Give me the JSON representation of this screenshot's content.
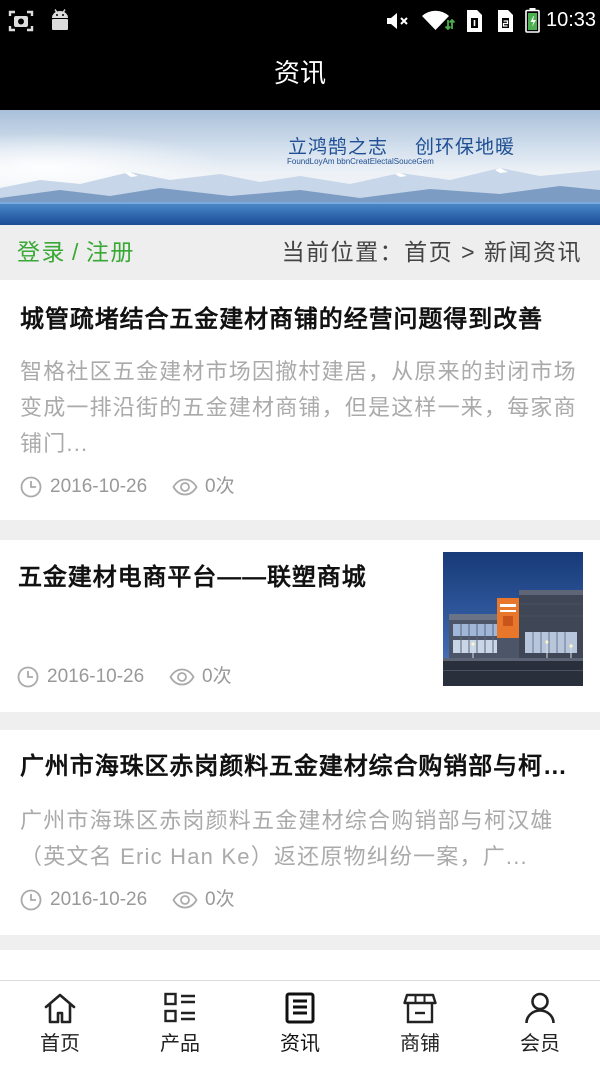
{
  "status_bar": {
    "time": "10:33",
    "left_icons": [
      "screenshot-icon",
      "android-icon"
    ],
    "right_icons": [
      "mute-icon",
      "wifi-icon",
      "sim1-icon",
      "sim2-icon",
      "battery-icon"
    ]
  },
  "header": {
    "title": "资讯"
  },
  "banner": {
    "slogan_1": "立鸿鹄之志",
    "slogan_2": "创环保地暖",
    "tagline": "FoundLoyAm bbnCreatElectalSouceGem"
  },
  "breadcrumb": {
    "login": "登录",
    "divider": "/",
    "register": "注册",
    "location_label": "当前位置：",
    "home": "首页",
    "separator": ">",
    "current": "新闻资讯"
  },
  "articles": [
    {
      "title": "城管疏堵结合五金建材商铺的经营问题得到改善",
      "excerpt": "智格社区五金建材市场因撤村建居，从原来的封闭市场变成一排沿街的五金建材商铺，但是这样一来，每家商铺门...",
      "date": "2016-10-26",
      "views": "0次",
      "has_thumbnail": false
    },
    {
      "title": "五金建材电商平台——联塑商城",
      "date": "2016-10-26",
      "views": "0次",
      "has_thumbnail": true
    },
    {
      "title": "广州市海珠区赤岗颜料五金建材综合购销部与柯…",
      "excerpt": "广州市海珠区赤岗颜料五金建材综合购销部与柯汉雄（英文名 Eric Han Ke）返还原物纠纷一案，广...",
      "date": "2016-10-26",
      "views": "0次",
      "has_thumbnail": false
    }
  ],
  "bottom_nav": {
    "items": [
      {
        "label": "首页",
        "icon": "home-icon"
      },
      {
        "label": "产品",
        "icon": "product-list-icon"
      },
      {
        "label": "资讯",
        "icon": "news-icon"
      },
      {
        "label": "商铺",
        "icon": "shop-icon"
      },
      {
        "label": "会员",
        "icon": "user-icon"
      }
    ],
    "active_index": 2
  },
  "colors": {
    "bar_background": "#000000",
    "accent_green": "#3aa835",
    "page_background": "#efefef",
    "title_text": "#111111",
    "muted_text": "#aaaaaa",
    "battery_green": "#4caf50"
  }
}
